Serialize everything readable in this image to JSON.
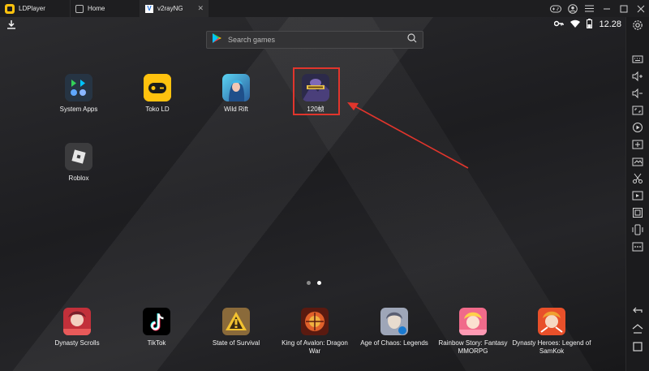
{
  "titlebar": {
    "app_name": "LDPlayer",
    "tabs": [
      {
        "label": "Home"
      },
      {
        "label": "v2rayNG"
      }
    ]
  },
  "status": {
    "time": "12.28"
  },
  "search": {
    "placeholder": "Search games"
  },
  "desktop_apps": [
    {
      "label": "System Apps"
    },
    {
      "label": "Toko LD"
    },
    {
      "label": "Wild Rift"
    },
    {
      "label": "120帧"
    },
    {
      "label": "Roblox"
    }
  ],
  "dock_apps": [
    {
      "label": "Dynasty Scrolls"
    },
    {
      "label": "TikTok"
    },
    {
      "label": "State of Survival"
    },
    {
      "label": "King of Avalon: Dragon War"
    },
    {
      "label": "Age of Chaos: Legends"
    },
    {
      "label": "Rainbow Story: Fantasy MMORPG"
    },
    {
      "label": "Dynasty Heroes: Legend of SamKok"
    }
  ],
  "pager": {
    "pages": 2,
    "active_index": 1
  },
  "colors": {
    "accent_yellow": "#ffc20e",
    "highlight_red": "#e1352c",
    "background": "#1c1c1e"
  },
  "icons": {
    "sidebar": [
      "settings-icon",
      "keyboard-icon",
      "volume-up-icon",
      "volume-down-icon",
      "screen-resize-icon",
      "record-icon",
      "add-apk-icon",
      "screenshot-icon",
      "scissors-icon",
      "multi-instance-icon",
      "sync-icon",
      "shake-icon",
      "more-icon",
      "back-icon",
      "home-icon",
      "recent-apps-icon"
    ]
  }
}
